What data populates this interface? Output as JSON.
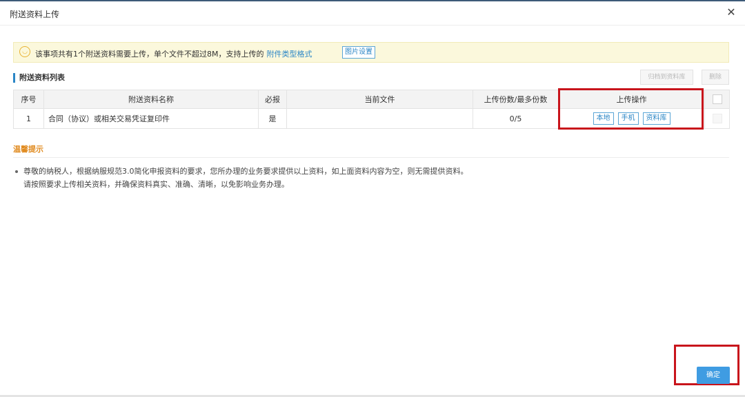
{
  "dialog": {
    "title": "附送资料上传",
    "close_glyph": "✕"
  },
  "notice": {
    "icon": "smile-icon",
    "text": "该事项共有1个附送资料需要上传，单个文件不超过8M，支持上传的",
    "link": "附件类型格式",
    "image_settings": "图片设置"
  },
  "section": {
    "title": "附送资料列表",
    "archive_button": "归档到资料库",
    "delete_button": "删除"
  },
  "table": {
    "headers": [
      "序号",
      "附送资料名称",
      "必报",
      "当前文件",
      "上传份数/最多份数",
      "上传操作"
    ],
    "rows": [
      {
        "index": "1",
        "name": "合同（协议）或相关交易凭证复印件",
        "required": "是",
        "current_file": "",
        "count": "0/5",
        "actions": [
          "本地",
          "手机",
          "资料库"
        ]
      }
    ]
  },
  "tips": {
    "title": "温馨提示",
    "line1": "尊敬的纳税人，根据纳服规范3.0简化申报资料的要求，您所办理的业务要求提供以上资料，如上面资料内容为空，则无需提供资料。",
    "line2": "请按照要求上传相关资料，并确保资料真实、准确、清晰，以免影响业务办理。"
  },
  "footer": {
    "confirm_button": "确定"
  },
  "colors": {
    "accent": "#2b86c6",
    "highlight_frame": "#c8141b",
    "notice_bg": "#fbf8dc",
    "tips_title": "#e08a1e",
    "confirm_bg": "#3f9ce2"
  }
}
